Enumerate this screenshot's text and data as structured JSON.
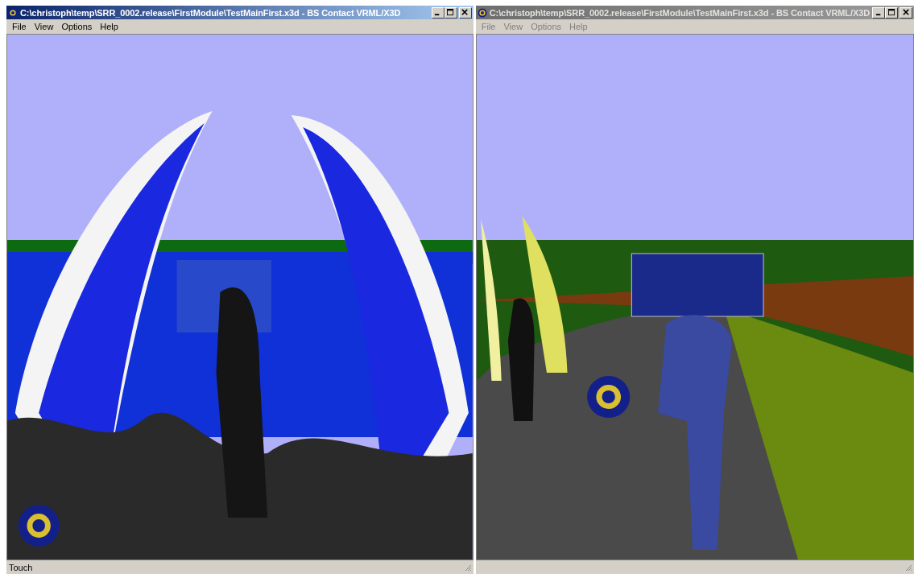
{
  "windows": [
    {
      "title": "C:\\christoph\\temp\\SRR_0002.release\\FirstModule\\TestMainFirst.x3d - BS Contact VRML/X3D",
      "active": true,
      "menu": [
        "File",
        "View",
        "Options",
        "Help"
      ],
      "status": "Touch"
    },
    {
      "title": "C:\\christoph\\temp\\SRR_0002.release\\FirstModule\\TestMainFirst.x3d - BS Contact VRML/X3D",
      "active": false,
      "menu": [
        "File",
        "View",
        "Options",
        "Help"
      ]
    }
  ]
}
